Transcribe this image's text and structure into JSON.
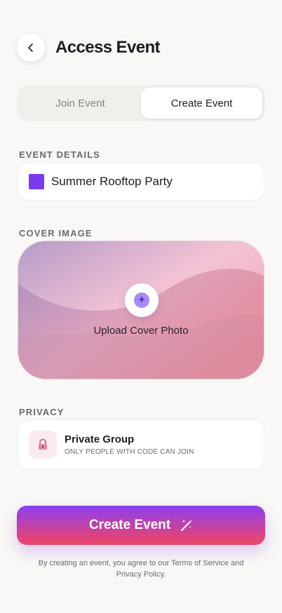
{
  "header": {
    "back_icon": "chevron-left-icon",
    "title": "Access Event"
  },
  "tabs": [
    {
      "label": "Join Event",
      "active": false
    },
    {
      "label": "Create Event",
      "active": true
    }
  ],
  "event_details": {
    "section_label": "EVENT DETAILS",
    "event_name": "Summer Rooftop Party",
    "color": "#7c3aed"
  },
  "cover_image": {
    "section_label": "COVER IMAGE",
    "upload_label": "Upload Cover Photo",
    "plus_glyph": "+"
  },
  "privacy": {
    "section_label": "PRIVACY",
    "icon": "lock-icon",
    "title": "Private Group",
    "subtitle": "ONLY PEOPLE WITH CODE CAN JOIN"
  },
  "cta": {
    "label": "Create Event",
    "icon": "magic-wand-icon"
  },
  "terms": {
    "prefix": "By creating an event, you agree to our ",
    "terms_link": "Terms of Service",
    "middle": " and ",
    "privacy_link": "Privacy Policy",
    "suffix": "."
  },
  "colors": {
    "background": "#f9f8f6",
    "accent_purple": "#8b3ff1",
    "accent_pink": "#e1447a"
  }
}
